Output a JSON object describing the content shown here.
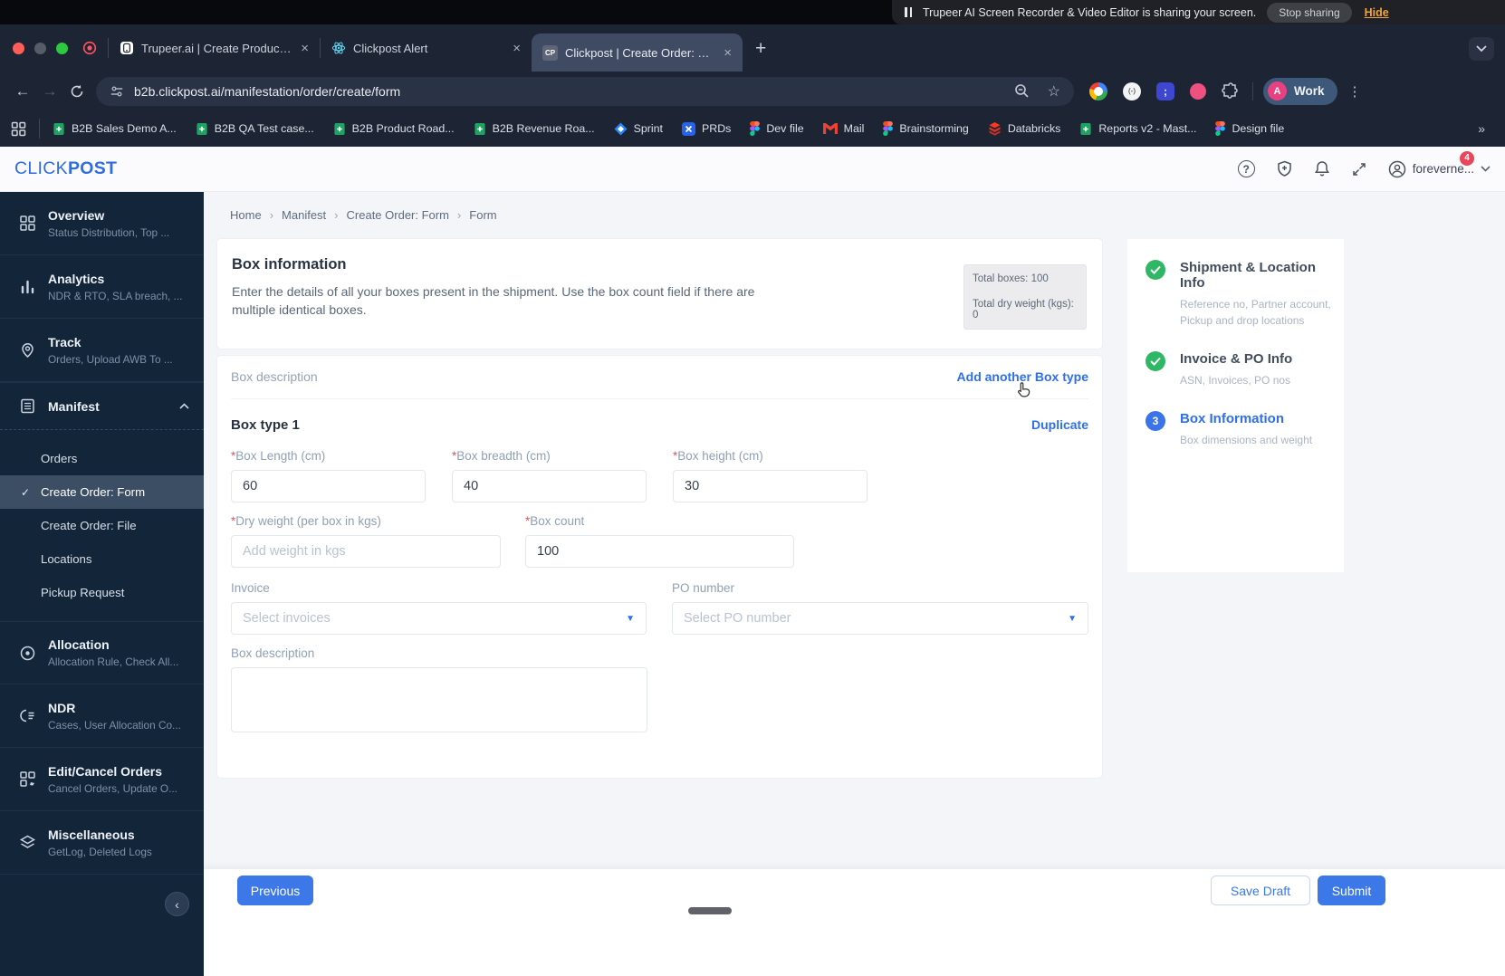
{
  "glyphs": {
    "help": "?",
    "close": "×",
    "plus": "+",
    "overflow": "»",
    "crumb_sep": "›",
    "dropdown": "▼",
    "menu_dots": "⋮",
    "collapse": "‹",
    "check": "✓",
    "back": "←",
    "forward": "→",
    "star": "☆",
    "ext_semicolon": ";",
    "ext_paren": "(-)"
  },
  "share_bar": {
    "message": "Trupeer AI Screen Recorder & Video Editor is sharing your screen.",
    "stop_button": "Stop sharing",
    "hide_link": "Hide"
  },
  "browser": {
    "tabs": [
      {
        "title": "Trupeer.ai | Create Product Vi"
      },
      {
        "title": "Clickpost Alert"
      },
      {
        "title": "Clickpost | Create Order: Form",
        "favicon": "CP"
      }
    ],
    "url": "b2b.clickpost.ai/manifestation/order/create/form",
    "profile": {
      "avatar": "A",
      "label": "Work"
    },
    "bookmarks": [
      {
        "label": "B2B Sales Demo A..."
      },
      {
        "label": "B2B QA Test case..."
      },
      {
        "label": "B2B Product Road..."
      },
      {
        "label": "B2B Revenue Roa..."
      },
      {
        "label": "Sprint"
      },
      {
        "label": "PRDs"
      },
      {
        "label": "Dev file"
      },
      {
        "label": "Mail"
      },
      {
        "label": "Brainstorming"
      },
      {
        "label": "Databricks"
      },
      {
        "label": "Reports v2 - Mast..."
      },
      {
        "label": "Design file"
      }
    ]
  },
  "header": {
    "logo_light": "CLICK",
    "logo_bold": "POST",
    "username": "foreverne...",
    "badge": "4"
  },
  "sidebar": {
    "items": [
      {
        "label": "Overview",
        "subtitle": "Status Distribution, Top ..."
      },
      {
        "label": "Analytics",
        "subtitle": "NDR & RTO, SLA breach, ..."
      },
      {
        "label": "Track",
        "subtitle": "Orders, Upload AWB To ..."
      },
      {
        "label": "Manifest",
        "subtitle": ""
      },
      {
        "label": "Allocation",
        "subtitle": "Allocation Rule, Check All..."
      },
      {
        "label": "NDR",
        "subtitle": "Cases, User Allocation Co..."
      },
      {
        "label": "Edit/Cancel Orders",
        "subtitle": "Cancel Orders, Update O..."
      },
      {
        "label": "Miscellaneous",
        "subtitle": "GetLog, Deleted Logs"
      }
    ],
    "manifest_children": [
      {
        "label": "Orders"
      },
      {
        "label": "Create Order: Form"
      },
      {
        "label": "Create Order: File"
      },
      {
        "label": "Locations"
      },
      {
        "label": "Pickup Request"
      }
    ]
  },
  "breadcrumb": {
    "items": [
      {
        "label": "Home"
      },
      {
        "label": "Manifest"
      },
      {
        "label": "Create Order: Form"
      },
      {
        "label": "Form"
      }
    ]
  },
  "box_info": {
    "title": "Box information",
    "description": "Enter the details of all your boxes present in the shipment. Use the box count field if there are multiple identical boxes.",
    "total_boxes": "Total boxes: 100",
    "total_weight": "Total dry weight (kgs): 0"
  },
  "form": {
    "section_label": "Box description",
    "add_link": "Add another Box type",
    "box_type_title": "Box type 1",
    "duplicate_link": "Duplicate",
    "required_marker": "*",
    "length": {
      "label": "Box Length (cm)",
      "value": "60"
    },
    "breadth": {
      "label": "Box breadth (cm)",
      "value": "40"
    },
    "height": {
      "label": "Box height (cm)",
      "value": "30"
    },
    "dry_weight": {
      "label": "Dry weight (per box in kgs)",
      "placeholder": "Add weight in kgs"
    },
    "box_count": {
      "label": "Box count",
      "value": "100"
    },
    "invoice": {
      "label": "Invoice",
      "placeholder": "Select invoices"
    },
    "po_number": {
      "label": "PO number",
      "placeholder": "Select PO number"
    },
    "description": {
      "label": "Box description"
    }
  },
  "stepper": {
    "steps": [
      {
        "title": "Shipment & Location Info",
        "subtitle": "Reference no, Partner account, Pickup and drop locations",
        "state": "done"
      },
      {
        "title": "Invoice & PO Info",
        "subtitle": "ASN, Invoices, PO nos",
        "state": "done"
      },
      {
        "title": "Box Information",
        "subtitle": "Box dimensions and weight",
        "state": "active",
        "number": "3"
      }
    ]
  },
  "footer": {
    "previous": "Previous",
    "save_draft": "Save Draft",
    "submit": "Submit"
  },
  "colors": {
    "accent_blue": "#2F6FED",
    "button_blue": "#3C78E7",
    "step_green": "#2FB765",
    "badge_red": "#E8465A",
    "sidebar_bg": "#132539",
    "chrome_bg": "#1D2433"
  }
}
